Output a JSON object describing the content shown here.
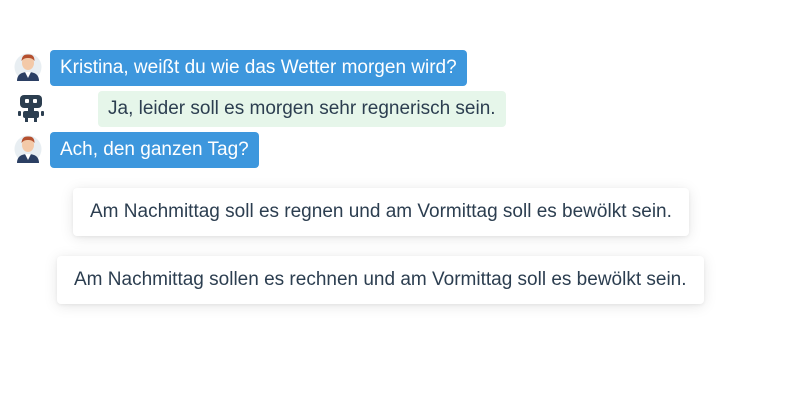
{
  "conversation": {
    "messages": [
      {
        "sender": "user",
        "avatar_icon": "user-avatar-icon",
        "text": "Kristina, weißt du wie das Wetter morgen wird?"
      },
      {
        "sender": "bot",
        "avatar_icon": "robot-avatar-icon",
        "text": "Ja, leider soll es morgen sehr regnerisch sein."
      },
      {
        "sender": "user",
        "avatar_icon": "user-avatar-icon",
        "text": "Ach, den ganzen Tag?"
      }
    ]
  },
  "reply_options": [
    {
      "text": "Am Nachmittag soll es regnen und am Vormittag soll es bewölkt sein."
    },
    {
      "text": "Am Nachmittag sollen es rechnen und am Vormittag soll es bewölkt sein."
    }
  ],
  "colors": {
    "user_bubble": "#3d97dd",
    "bot_bubble": "#e6f6ea",
    "text_dark": "#2c3e50"
  }
}
